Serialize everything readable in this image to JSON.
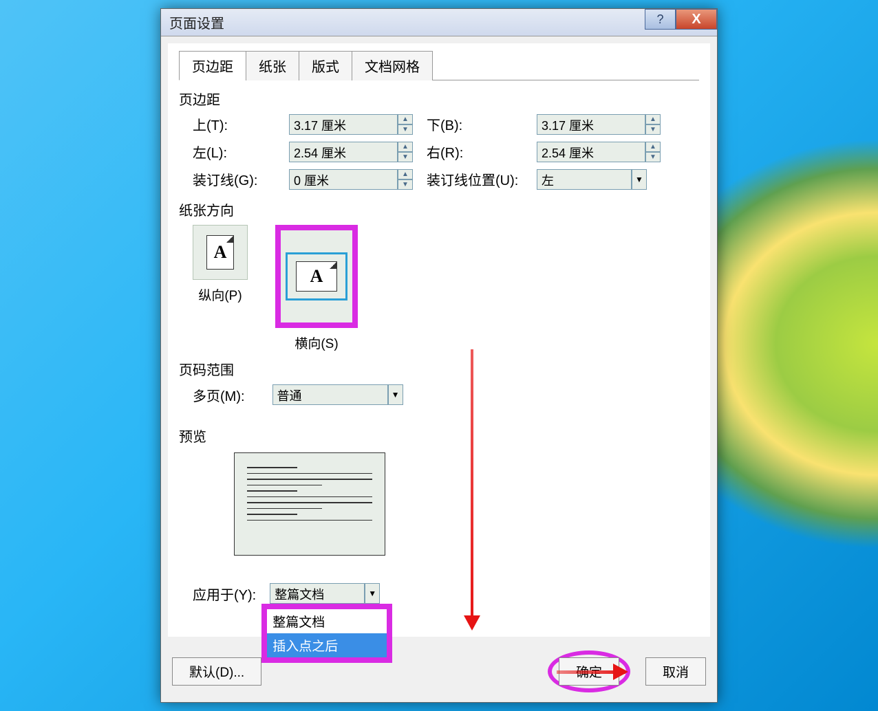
{
  "title": "页面设置",
  "tabs": [
    "页边距",
    "纸张",
    "版式",
    "文档网格"
  ],
  "margins": {
    "section": "页边距",
    "top_label": "上(T):",
    "top_value": "3.17 厘米",
    "bottom_label": "下(B):",
    "bottom_value": "3.17 厘米",
    "left_label": "左(L):",
    "left_value": "2.54 厘米",
    "right_label": "右(R):",
    "right_value": "2.54 厘米",
    "gutter_label": "装订线(G):",
    "gutter_value": "0 厘米",
    "gutter_pos_label": "装订线位置(U):",
    "gutter_pos_value": "左"
  },
  "orientation": {
    "section": "纸张方向",
    "portrait": "纵向(P)",
    "landscape": "横向(S)"
  },
  "page_range": {
    "section": "页码范围",
    "multi_label": "多页(M):",
    "multi_value": "普通"
  },
  "preview_label": "预览",
  "apply": {
    "label": "应用于(Y):",
    "value": "整篇文档",
    "options": [
      "整篇文档",
      "插入点之后"
    ]
  },
  "footer": {
    "default": "默认(D)...",
    "ok": "确定",
    "cancel": "取消"
  },
  "titlebar_help": "?",
  "titlebar_close": "X"
}
